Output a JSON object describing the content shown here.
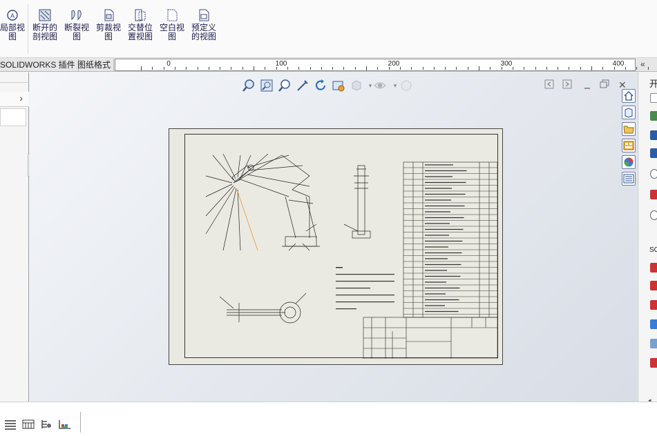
{
  "ribbon": {
    "buttons": [
      {
        "line1": "局部视",
        "line2": "图",
        "icon": "detail-view-icon"
      },
      {
        "line1": "断开的",
        "line2": "剖视图",
        "icon": "broken-out-section-icon"
      },
      {
        "line1": "断裂视",
        "line2": "图",
        "icon": "break-view-icon"
      },
      {
        "line1": "剪裁视",
        "line2": "图",
        "icon": "crop-view-icon"
      },
      {
        "line1": "交替位",
        "line2": "置视图",
        "icon": "alternate-position-view-icon"
      },
      {
        "line1": "空白视",
        "line2": "图",
        "icon": "empty-view-icon"
      },
      {
        "line1": "预定义",
        "line2": "的视图",
        "icon": "predefined-view-icon"
      }
    ]
  },
  "tabs": {
    "addins": "SOLIDWORKS 插件",
    "sheet_format": "图纸格式"
  },
  "ruler": {
    "labels": [
      "0",
      "100",
      "200",
      "300",
      "400"
    ]
  },
  "drawing": {
    "tech_req": "技术要求",
    "bom_title": "序号 名称 数量"
  },
  "rightpane": {
    "label_top": "开",
    "label_mid": "SO"
  },
  "icons": {
    "accent": "#2a4c8a"
  }
}
